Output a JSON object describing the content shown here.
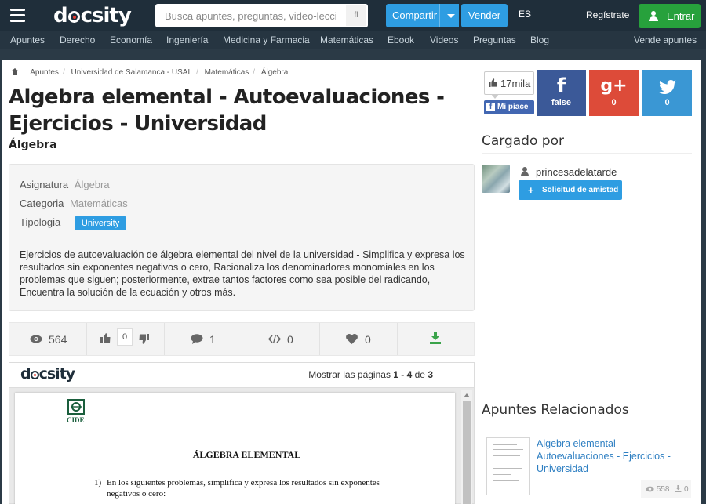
{
  "header": {
    "search_placeholder": "Busca apuntes, preguntas, video-leccion",
    "search_button": "fl",
    "share_label": "Compartir",
    "sell_label": "Vender",
    "lang": "ES",
    "register": "Regístrate",
    "login": "Entrar"
  },
  "categories": [
    "Apuntes",
    "Derecho",
    "Economía",
    "Ingeniería",
    "Medicina y Farmacia",
    "Matemáticas",
    "Ebook",
    "Videos",
    "Preguntas",
    "Blog"
  ],
  "sell_notes": "Vende apuntes",
  "breadcrumb": [
    "Apuntes",
    "Universidad de Salamanca - USAL",
    "Matemáticas",
    "Álgebra"
  ],
  "document": {
    "title": "Algebra elemental - Autoevaluaciones - Ejercicios - Universidad",
    "subject": "Álgebra",
    "info": {
      "asignatura_label": "Asignatura",
      "asignatura_value": "Álgebra",
      "categoria_label": "Categoria",
      "categoria_value": "Matemáticas",
      "tipologia_label": "Tipologia",
      "tipologia_value": "University"
    },
    "description": "Ejercicios de autoevaluación de álgebra elemental del nivel de la universidad - Simplifica y expresa los resultados sin exponentes negativos o cero, Racionaliza los denominadores monomiales en los problemas que siguen; posteriormente, extrae tantos factores como sea posible del radicando, Encuentra la solución de la ecuación y otros más."
  },
  "stats": {
    "views": "564",
    "votes": "0",
    "comments": "1",
    "embeds": "0",
    "favorites": "0"
  },
  "viewer": {
    "pages_prefix": "Mostrar las páginas ",
    "pages_range": "1 - 4",
    "pages_of": " de ",
    "pages_total": "3",
    "page_header": "CIDE",
    "page_title": "ÁLGEBRA ELEMENTAL",
    "page_q_num": "1)",
    "page_q_line1": "En los siguientes problemas, simplifica y expresa los resultados sin exponentes",
    "page_q_line2": "negativos o cero:"
  },
  "social": {
    "likes": "17mila",
    "fb_like": "Mi piace",
    "facebook_count": "false",
    "google_count": "0",
    "twitter_count": "0"
  },
  "uploader": {
    "section_title": "Cargado por",
    "name": "princesadelatarde",
    "friend_button": "Solicitud de amistad"
  },
  "related": {
    "section_title": "Apuntes Relacionados",
    "items": [
      {
        "title": "Algebra elemental - Autoevaluaciones - Ejercicios - Universidad",
        "views": "558",
        "downloads": "0"
      }
    ]
  },
  "colors": {
    "brand_blue": "#2e9de2",
    "enter_green": "#27a13c",
    "facebook": "#3b5998",
    "google": "#dd4b39",
    "twitter": "#3a97d4",
    "topbar": "#1f2e3a"
  }
}
